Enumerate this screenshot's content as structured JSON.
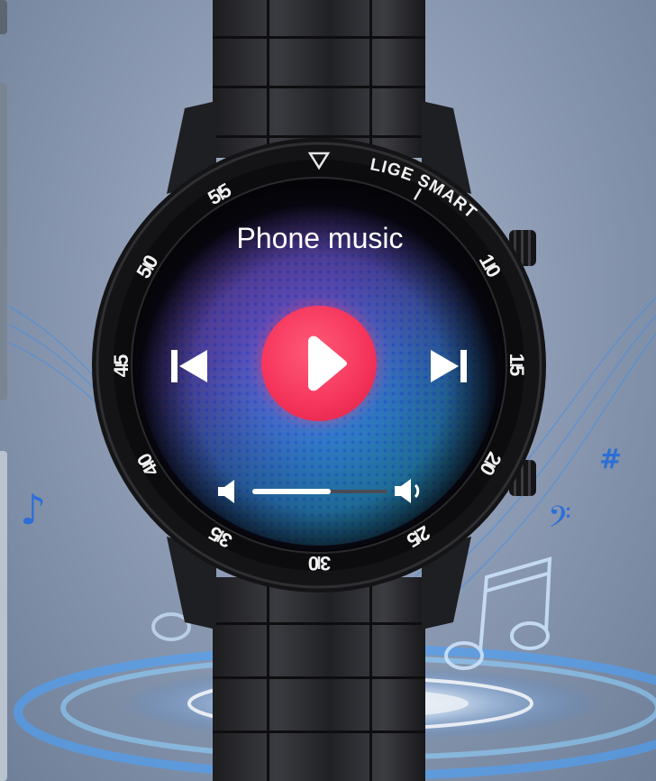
{
  "watch": {
    "brand_text": "LIGE SMART",
    "bezel_numbers": [
      "55",
      "10",
      "15",
      "20",
      "25",
      "30",
      "35",
      "40",
      "45",
      "50"
    ],
    "screen_title": "Phone music",
    "volume_level": 0.58
  },
  "controls": {
    "previous_icon": "skip-previous-icon",
    "play_icon": "play-icon",
    "next_icon": "skip-next-icon",
    "volume_down_icon": "volume-low-icon",
    "volume_up_icon": "volume-high-icon"
  },
  "decorations": {
    "symbols": [
      "#"
    ]
  },
  "colors": {
    "play_button": "#f5335a",
    "background": "#8e9db5",
    "accent_blue": "#2d6fd6"
  }
}
